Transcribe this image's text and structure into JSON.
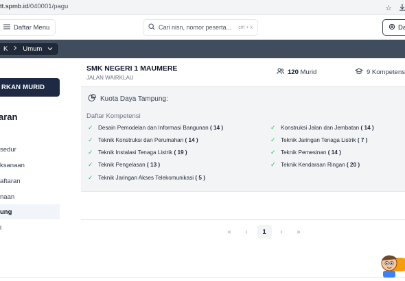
{
  "browser": {
    "url_host": "tt.spmb.id",
    "url_path": "/040001/pagu"
  },
  "header": {
    "menu_label": "Daftar Menu",
    "search_placeholder": "Cari nisn, nomor peserta...",
    "search_shortcut": "ctrl + k",
    "right_button_label": "Da"
  },
  "breadcrumb": {
    "prefix": "K",
    "current": "Umum"
  },
  "sidebar": {
    "cta_label": "RKAN MURID",
    "heading": "aran",
    "items": [
      {
        "label": "sedur"
      },
      {
        "label": "ksanaan"
      },
      {
        "label": "aftaran"
      },
      {
        "label": "naan"
      },
      {
        "label": "ung"
      },
      {
        "label": "i"
      }
    ]
  },
  "school": {
    "name": "SMK NEGERI 1 MAUMERE",
    "address": "JALAN WAIRKLAU",
    "murid_count": "120",
    "murid_label": "Murid",
    "kompetensi_label": "9 Kompetensi"
  },
  "panel": {
    "kuota_label": "Kuota Daya Tampung:",
    "list_title": "Daftar Kompetensi",
    "kompetensi": [
      {
        "name": "Desain Pemodelan dan Informasi Bangunan",
        "count": "( 14 )"
      },
      {
        "name": "Konstruksi Jalan dan Jembatan",
        "count": "( 14 )"
      },
      {
        "name": "Teknik Konstruksi dan Perumahan",
        "count": "( 14 )"
      },
      {
        "name": "Teknik Jaringan Tenaga Listrik",
        "count": "( 7 )"
      },
      {
        "name": "Teknik Instalasi Tenaga Listrik",
        "count": "( 19 )"
      },
      {
        "name": "Teknik Pemesinan",
        "count": "( 14 )"
      },
      {
        "name": "Teknik Pengelasan",
        "count": "( 13 )"
      },
      {
        "name": "Teknik Kendaraan Ringan",
        "count": "( 20 )"
      },
      {
        "name": "Teknik Jaringan Akses Telekomunikasi",
        "count": "( 5 )"
      }
    ]
  },
  "pagination": {
    "first": "«",
    "prev": "‹",
    "current_page": "1",
    "next": "›",
    "last": "»"
  },
  "colors": {
    "band": "#3f4d5f",
    "cta": "#1e2a44",
    "check": "#22c55e",
    "panel": "#f3f4f6"
  },
  "icons": [
    "star-icon",
    "download-icon",
    "hamburger-icon",
    "search-icon",
    "chevron-right-icon",
    "chevron-down-icon",
    "users-icon",
    "graduation-cap-icon",
    "pie-chart-icon",
    "check-icon",
    "settings-icon"
  ]
}
